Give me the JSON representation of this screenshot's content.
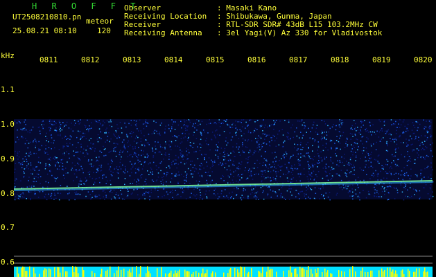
{
  "header": {
    "title": "H R O F F T",
    "filename": "UT2508210810.pn",
    "mode": "meteor",
    "date": "25.08.21 08:10",
    "count": "120",
    "fields": [
      {
        "label": "Observer",
        "value": ": Masaki Kano"
      },
      {
        "label": "Receiving Location",
        "value": ": Shibukawa, Gunma, Japan"
      },
      {
        "label": "Receiver",
        "value": ": RTL-SDR SDR# 43dB L15 103.2MHz CW"
      },
      {
        "label": "Receiving Antenna",
        "value": ": 3el Yagi(V) Az 330 for Vladivostok"
      }
    ]
  },
  "axes": {
    "y_unit": "kHz",
    "y_ticks": [
      "1.1",
      "1.0",
      "0.9",
      "0.8",
      "0.7",
      "0.6"
    ],
    "x_ticks": [
      "0811",
      "0812",
      "0813",
      "0814",
      "0815",
      "0816",
      "0817",
      "0818",
      "0819",
      "0820"
    ]
  },
  "colors": {
    "text": "#ffff3a",
    "title": "#33dd33",
    "noise_low": "#0b1a7a",
    "noise_high": "#2fb4ff",
    "trace": "#7fffa0",
    "bottom_bar_cyan": "#00e0ff",
    "bottom_bar_yellow": "#ffff00"
  }
}
